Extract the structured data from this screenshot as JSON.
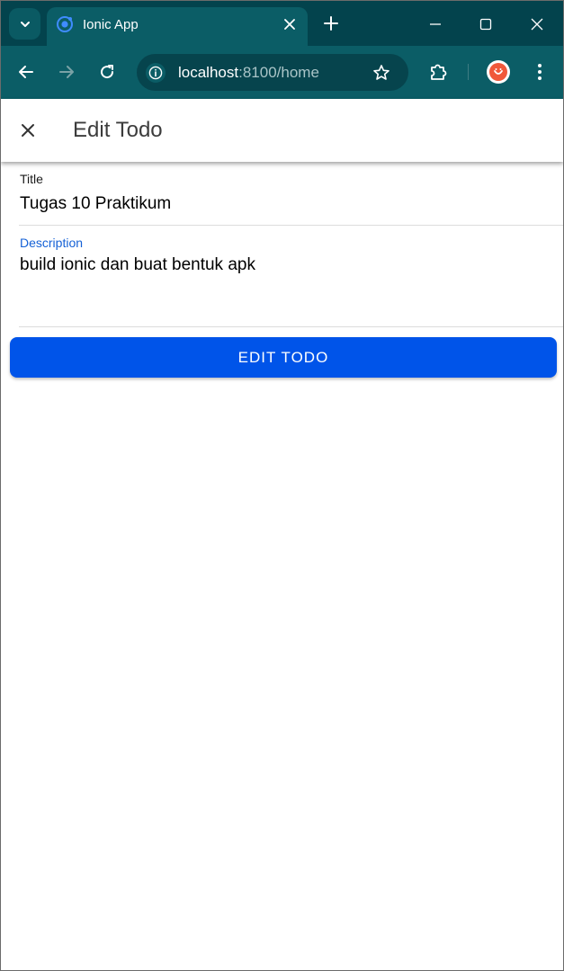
{
  "browser": {
    "tab": {
      "title": "Ionic App"
    },
    "address_bar": {
      "host": "localhost",
      "rest": ":8100/home"
    },
    "theme_color": "#0b5d66"
  },
  "header": {
    "title": "Edit Todo"
  },
  "form": {
    "title_field": {
      "label": "Title",
      "value": "Tugas 10 Praktikum"
    },
    "description_field": {
      "label": "Description",
      "value": "build ionic dan buat bentuk apk"
    },
    "submit_label": "EDIT TODO"
  },
  "colors": {
    "primary": "#0054e9",
    "focused_label": "#1561d6"
  }
}
